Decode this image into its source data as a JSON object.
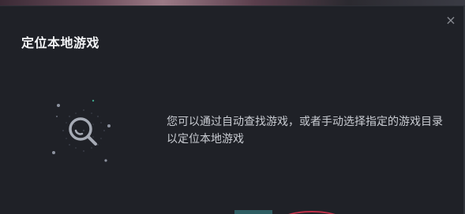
{
  "dialog": {
    "title": "定位本地游戏",
    "close_icon": "×",
    "description": "您可以通过自动查找游戏，或者手动选择指定的游戏目录以定位本地游戏",
    "illustration_icon": "search-magnifier-icon"
  },
  "colors": {
    "dialog_bg": "#1f2127",
    "title": "#f2f3f5",
    "text": "#c9ccd2",
    "accent_teal": "#2e5d62",
    "accent_red": "#c0324a"
  }
}
